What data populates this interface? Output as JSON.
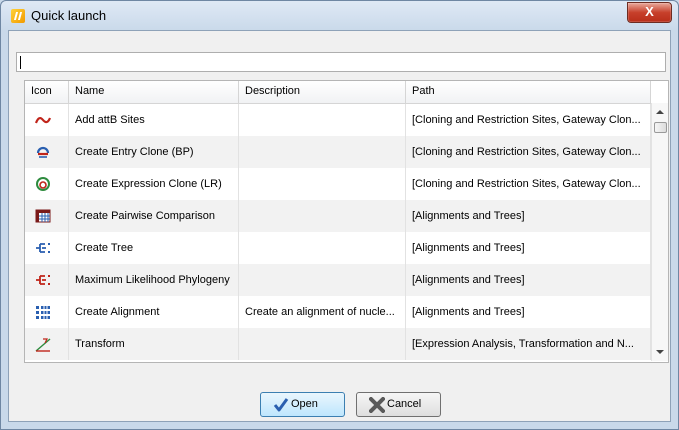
{
  "window": {
    "title": "Quick launch",
    "close_label": "X"
  },
  "search": {
    "value": ""
  },
  "table": {
    "headers": {
      "icon": "Icon",
      "name": "Name",
      "description": "Description",
      "path": "Path"
    },
    "rows": [
      {
        "icon": "attb-sites-icon",
        "name": "Add attB Sites",
        "description": "",
        "path": "[Cloning and Restriction Sites, Gateway Clon..."
      },
      {
        "icon": "entry-clone-icon",
        "name": "Create Entry Clone (BP)",
        "description": "",
        "path": "[Cloning and Restriction Sites, Gateway Clon..."
      },
      {
        "icon": "expression-clone-icon",
        "name": "Create Expression Clone (LR)",
        "description": "",
        "path": "[Cloning and Restriction Sites, Gateway Clon..."
      },
      {
        "icon": "pairwise-comparison-icon",
        "name": "Create Pairwise Comparison",
        "description": "",
        "path": "[Alignments and Trees]"
      },
      {
        "icon": "tree-icon",
        "name": "Create Tree",
        "description": "",
        "path": "[Alignments and Trees]"
      },
      {
        "icon": "phylogeny-icon",
        "name": "Maximum Likelihood Phylogeny",
        "description": "",
        "path": "[Alignments and Trees]"
      },
      {
        "icon": "alignment-icon",
        "name": "Create Alignment",
        "description": "Create an alignment of nucle...",
        "path": "[Alignments and Trees]"
      },
      {
        "icon": "transform-icon",
        "name": "Transform",
        "description": "",
        "path": "[Expression Analysis, Transformation and N..."
      }
    ]
  },
  "buttons": {
    "open": "Open",
    "cancel": "Cancel"
  }
}
